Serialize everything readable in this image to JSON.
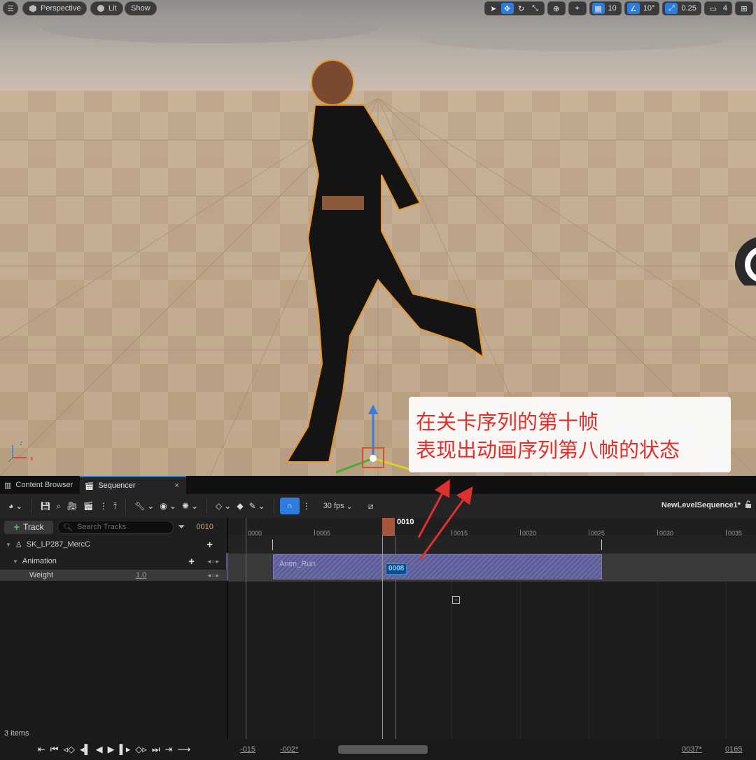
{
  "viewport": {
    "menu_icon": "hamburger-menu-icon",
    "perspective_label": "Perspective",
    "lit_label": "Lit",
    "show_label": "Show",
    "grid_snap_value": "10",
    "rotation_snap_value": "10°",
    "scale_snap_value": "0.25",
    "camera_speed_value": "4"
  },
  "annotation": {
    "line1": "在关卡序列的第十帧",
    "line2": "表现出动画序列第八帧的状态"
  },
  "tabs": {
    "content_browser": "Content Browser",
    "sequencer": "Sequencer",
    "close": "×"
  },
  "toolbar": {
    "fps": "30 fps",
    "sequence_name": "NewLevelSequence1*"
  },
  "tracks": {
    "add_track": "Track",
    "search_placeholder": "Search Tracks",
    "current_frame": "0010",
    "object_name": "SK_LP287_MercC",
    "animation_label": "Animation",
    "weight_label": "Weight",
    "weight_value": "1.0",
    "items_count": "3 items",
    "key_nav": "◂○▸"
  },
  "timeline": {
    "ticks": [
      "0000",
      "0005",
      "0015",
      "0020",
      "0025",
      "0030",
      "0035"
    ],
    "playhead_label": "0010",
    "clip_label": "Anim_Run",
    "clip_frame_badge": "0008",
    "range_start": "-015",
    "range_view_start": "-002*",
    "range_view_end": "0037*",
    "range_end": "0165"
  },
  "colors": {
    "accent": "#2d7de0",
    "playhead": "#a8553e",
    "annotation_text": "#e0302c",
    "clip": "#6a6aa6",
    "start_marker": "#2e8d2e"
  }
}
